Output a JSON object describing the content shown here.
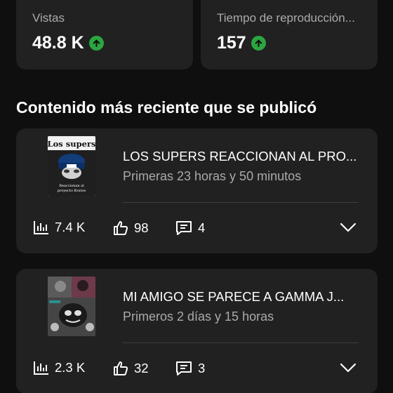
{
  "stats": {
    "views": {
      "label": "Vistas",
      "value": "48.8 K",
      "trend_icon": "arrow-up-circle-icon"
    },
    "watch_time": {
      "label": "Tiempo de reproducción...",
      "value": "157",
      "trend_icon": "arrow-up-circle-icon"
    }
  },
  "section": {
    "title": "Contenido más reciente que se publicó"
  },
  "videos": [
    {
      "title": "LOS SUPERS REACCIONAN AL PRO...",
      "subtitle": "Primeras 23 horas y 50 minutos",
      "thumb_top_text": "Los supers",
      "thumb_bottom_text": "Reaccionan al proyecto Kratos",
      "views": "7.4 K",
      "likes": "98",
      "comments": "4"
    },
    {
      "title": "MI AMIGO SE PARECE A GAMMA J...",
      "subtitle": "Primeros 2 días y 15 horas",
      "views": "2.3 K",
      "likes": "32",
      "comments": "3"
    }
  ],
  "colors": {
    "background": "#0f0f0f",
    "card": "#212121",
    "trend_up": "#2ba640",
    "muted_text": "#aaaaaa"
  }
}
